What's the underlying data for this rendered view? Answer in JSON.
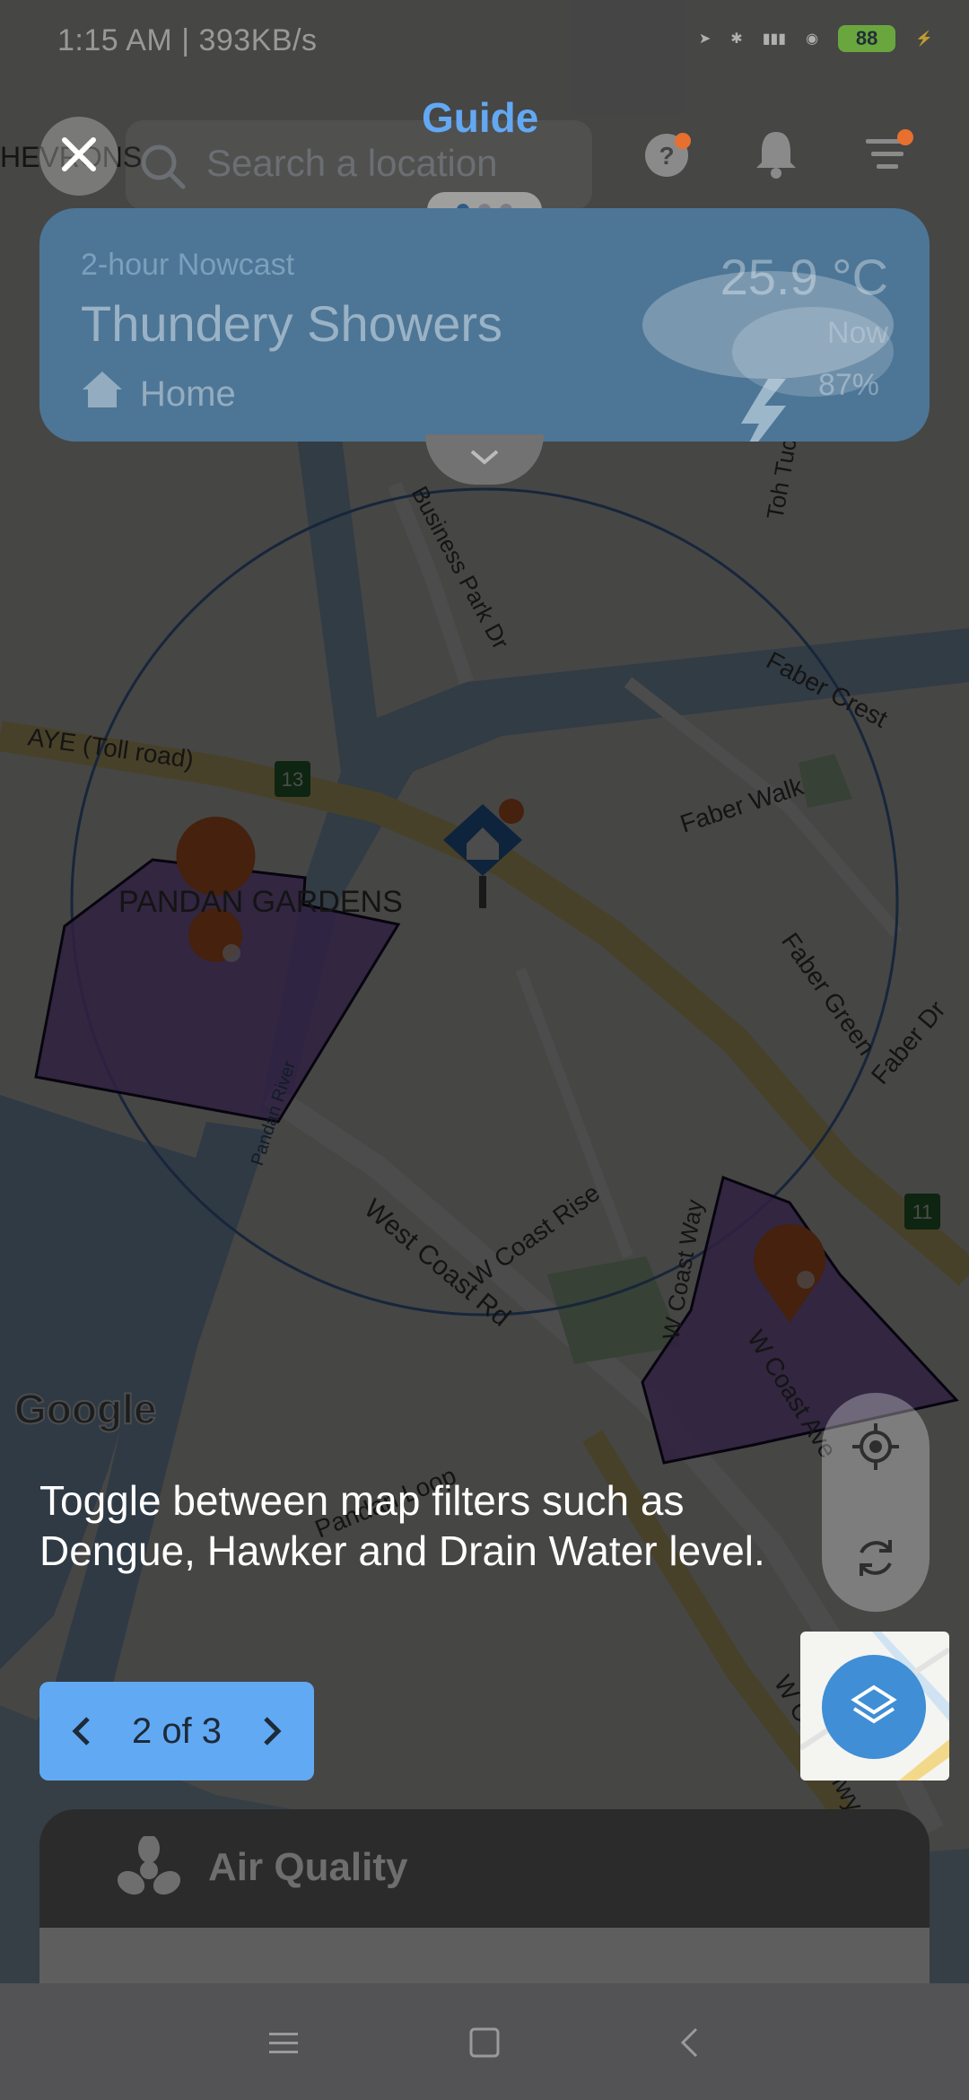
{
  "status_bar": {
    "left_text": "1:15 AM | 393KB/s",
    "battery": "88"
  },
  "top_bar": {
    "search_placeholder": "Search a location",
    "guide_title": "Guide"
  },
  "weather_card": {
    "subtitle": "2-hour Nowcast",
    "headline": "Thundery Showers",
    "location": "Home",
    "temperature": "25.9 °C",
    "time_label": "Now",
    "humidity": "87%"
  },
  "map": {
    "labels": {
      "hevrons": "HEVRONS",
      "aye": "AYE (Toll road)",
      "exit_13": "13",
      "exit_11": "11",
      "business_park": "Business Park Dr",
      "toh_tuck": "Toh Tuck",
      "faber_crest": "Faber Crest",
      "faber_walk": "Faber Walk",
      "faber_green": "Faber Green",
      "faber_dr": "Faber Dr",
      "pandan_gardens": "PANDAN GARDENS",
      "pandan_river": "Pandan River",
      "west_coast_rd": "West Coast Rd",
      "w_coast_rise": "W Coast Rise",
      "w_coast_way": "W Coast Way",
      "w_coast_ave": "W Coast Ave",
      "w_coast_hwy": "W Coast Hwy",
      "pandan_loop": "Pandan Loop",
      "google": "Google"
    }
  },
  "guide": {
    "text": "Toggle between map filters such as Dengue, Hawker and Drain Water level.",
    "pager": "2 of 3"
  },
  "bottom_card": {
    "label": "Air Quality"
  },
  "colors": {
    "accent_blue": "#62a9f3",
    "dengue_zone": "#9c6cd8",
    "dengue_pin": "#e7702f"
  },
  "icons": {
    "close": "close-icon",
    "search": "search-icon",
    "help": "help-bubble-icon",
    "bell": "bell-icon",
    "filter": "filter-icon",
    "locate": "my-location-icon",
    "refresh": "refresh-icon",
    "layers": "layers-icon",
    "air_quality": "fan-icon"
  }
}
